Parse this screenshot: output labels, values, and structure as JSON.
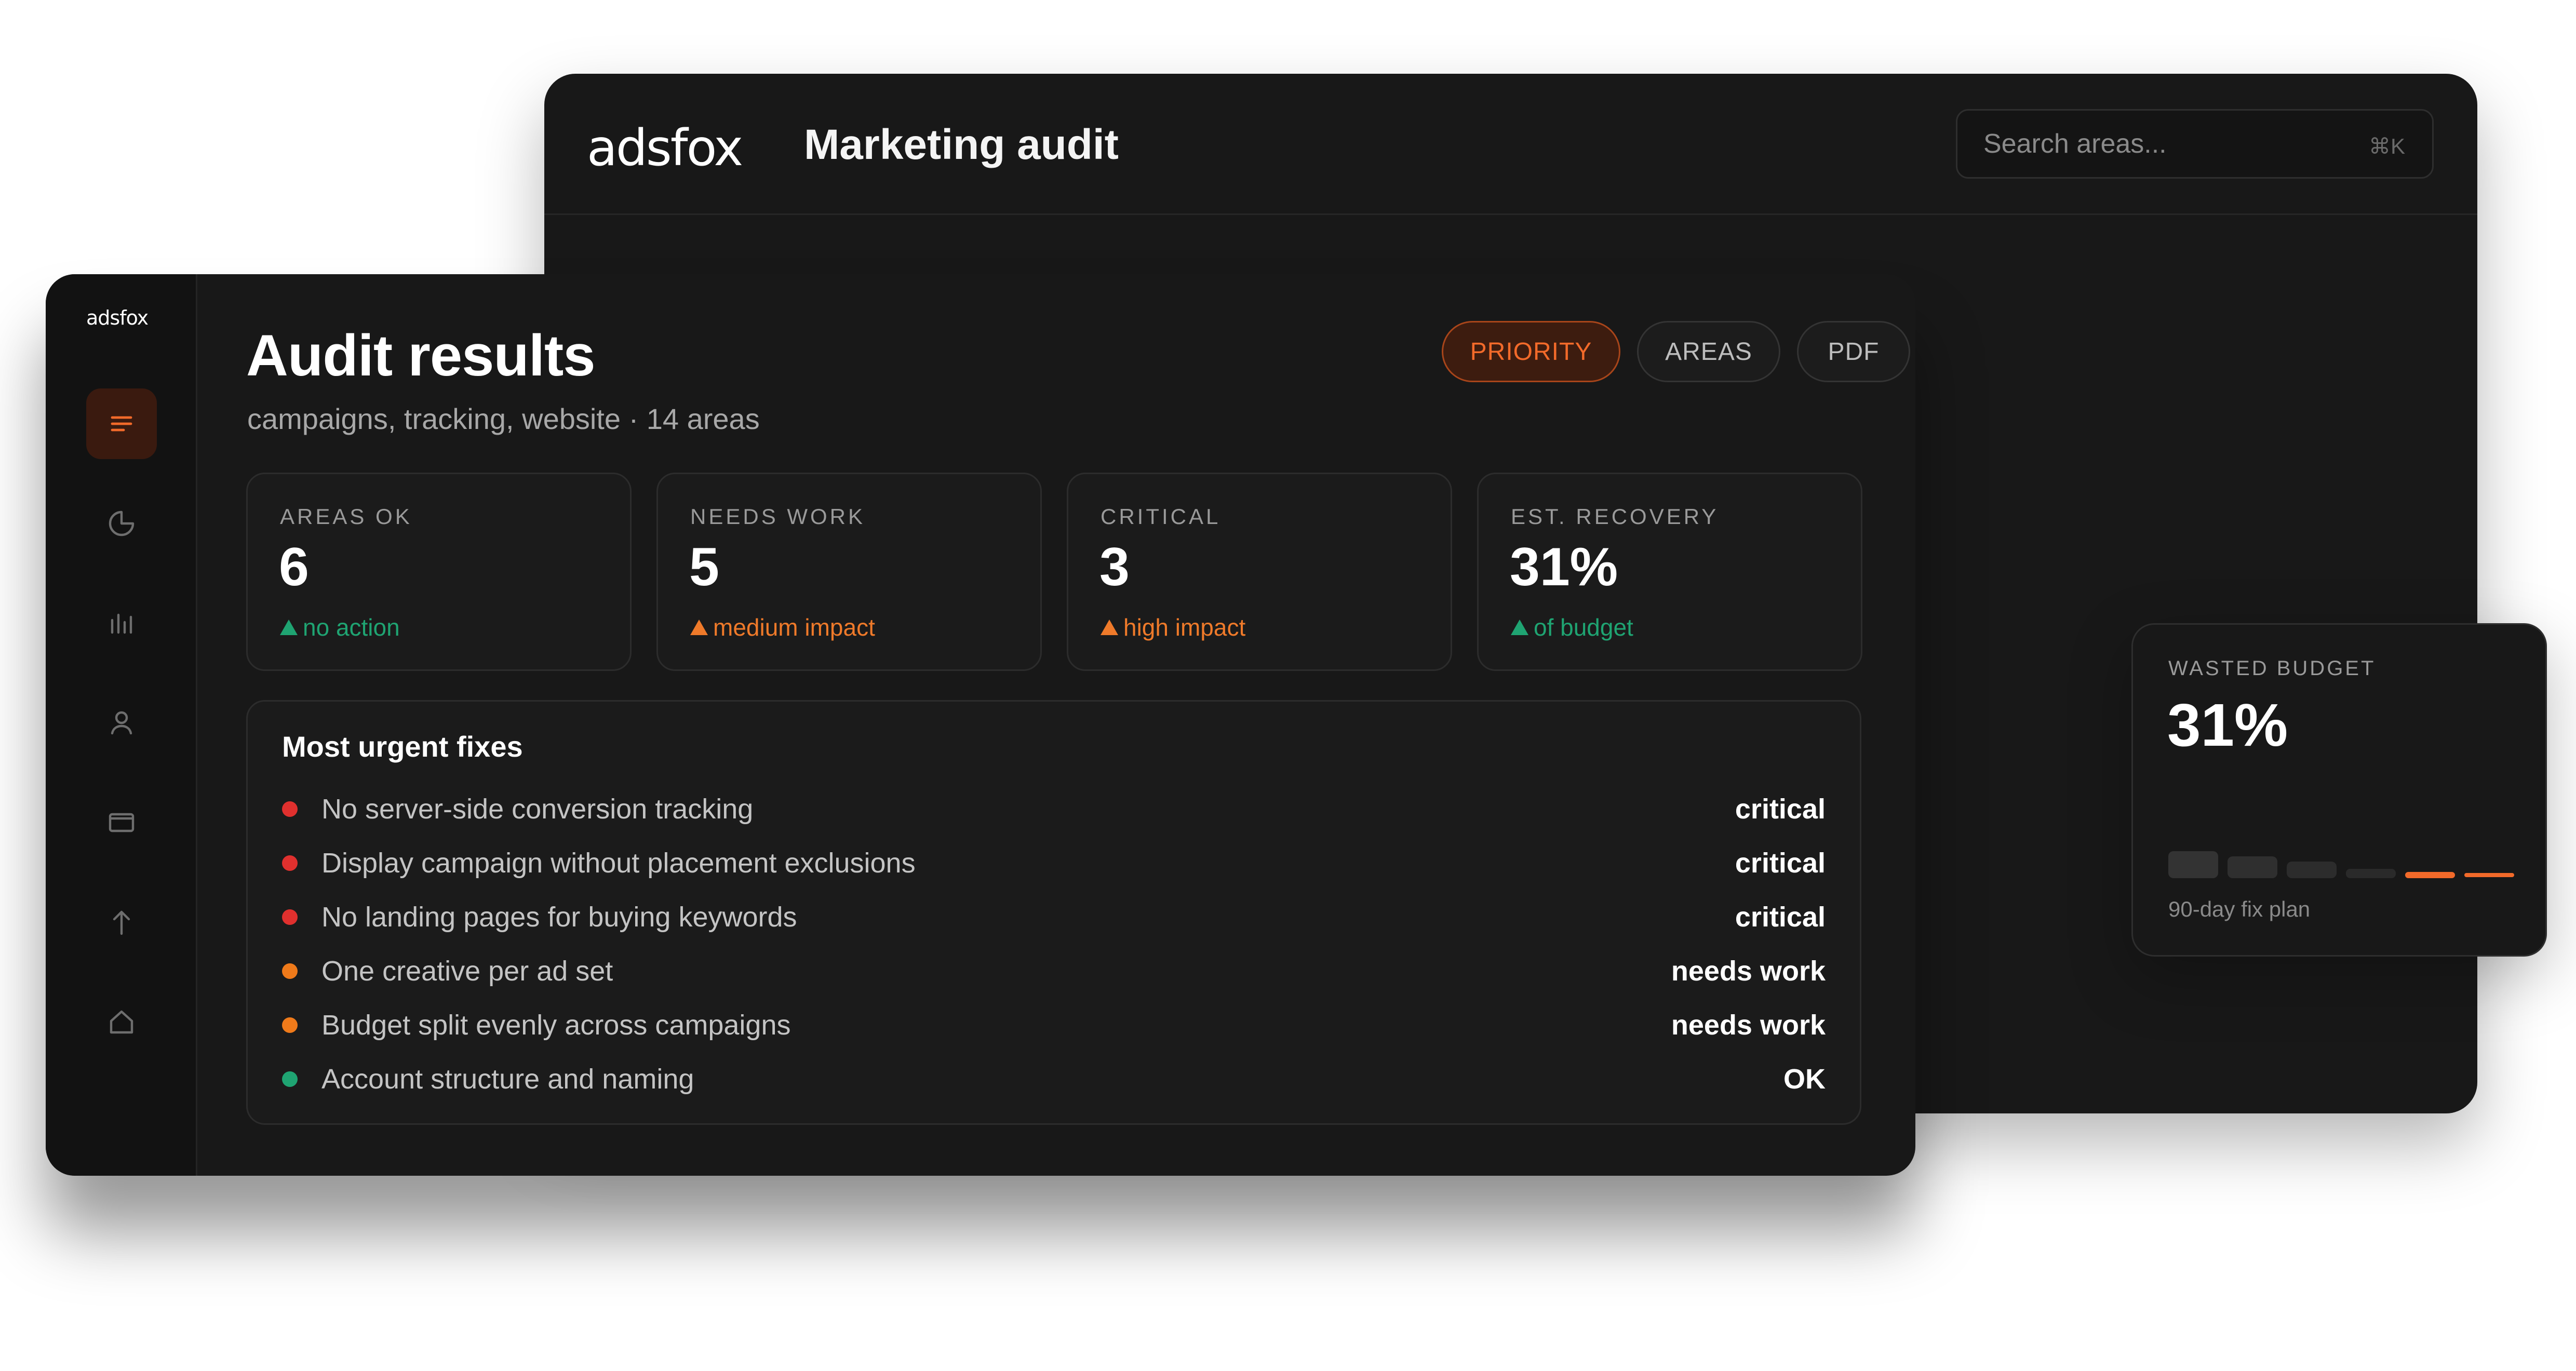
{
  "back_window": {
    "logo": "adsfox",
    "title": "Marketing audit",
    "search": {
      "placeholder": "Search areas...",
      "shortcut": "⌘K"
    }
  },
  "sidebar": {
    "logo": "adsfox",
    "items": [
      {
        "name": "list-icon",
        "active": true
      },
      {
        "name": "pie-chart-icon",
        "active": false
      },
      {
        "name": "bar-chart-icon",
        "active": false
      },
      {
        "name": "user-icon",
        "active": false
      },
      {
        "name": "card-icon",
        "active": false
      },
      {
        "name": "arrow-up-icon",
        "active": false
      },
      {
        "name": "home-icon",
        "active": false
      }
    ]
  },
  "main": {
    "title": "Audit results",
    "subtitle": "campaigns, tracking, website · 14 areas",
    "tabs": [
      {
        "label": "PRIORITY",
        "active": true
      },
      {
        "label": "AREAS",
        "active": false
      },
      {
        "label": "PDF",
        "active": false
      }
    ],
    "stats": [
      {
        "label": "AREAS OK",
        "value": "6",
        "note": "no action",
        "tone": "green"
      },
      {
        "label": "NEEDS WORK",
        "value": "5",
        "note": "medium impact",
        "tone": "orange"
      },
      {
        "label": "CRITICAL",
        "value": "3",
        "note": "high impact",
        "tone": "orange"
      },
      {
        "label": "EST. RECOVERY",
        "value": "31%",
        "note": "of budget",
        "tone": "green"
      }
    ],
    "fixes": {
      "title": "Most urgent fixes",
      "items": [
        {
          "label": "No server-side conversion tracking",
          "status": "critical",
          "color": "#e0302e"
        },
        {
          "label": "Display campaign without placement exclusions",
          "status": "critical",
          "color": "#e0302e"
        },
        {
          "label": "No landing pages for buying keywords",
          "status": "critical",
          "color": "#e0302e"
        },
        {
          "label": "One creative per ad set",
          "status": "needs work",
          "color": "#ef7a1a"
        },
        {
          "label": "Budget split evenly across campaigns",
          "status": "needs work",
          "color": "#ef7a1a"
        },
        {
          "label": "Account structure and naming",
          "status": "OK",
          "color": "#1fa472"
        }
      ]
    }
  },
  "wasted_budget": {
    "label": "WASTED BUDGET",
    "value": "31%",
    "caption": "90-day fix plan"
  },
  "colors": {
    "accent": "#f26a2a",
    "ok": "#1fa472",
    "critical": "#e0302e",
    "warning": "#ef7a1a"
  }
}
